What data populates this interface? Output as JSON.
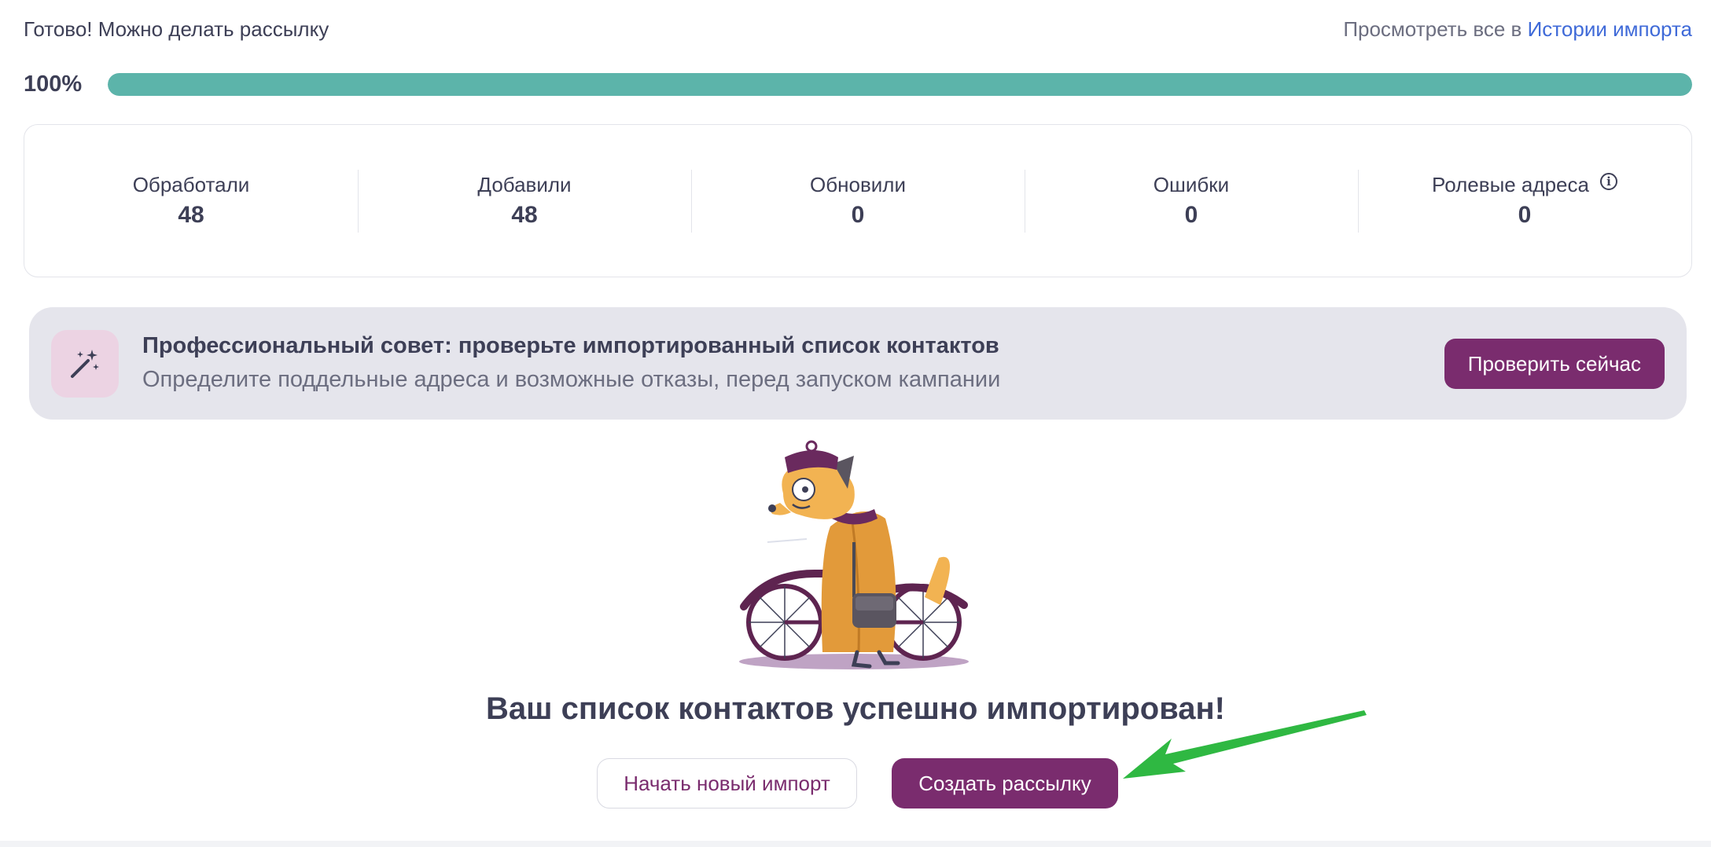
{
  "header": {
    "status_text": "Готово! Можно делать рассылку",
    "history_prefix": "Просмотреть все в ",
    "history_link": "Истории импорта"
  },
  "progress": {
    "label": "100%",
    "value": 1.0
  },
  "stats": [
    {
      "label": "Обработали",
      "value": "48"
    },
    {
      "label": "Добавили",
      "value": "48"
    },
    {
      "label": "Обновили",
      "value": "0"
    },
    {
      "label": "Ошибки",
      "value": "0"
    },
    {
      "label": "Ролевые адреса",
      "value": "0"
    }
  ],
  "tip": {
    "title": "Профессиональный совет: проверьте импортированный список контактов",
    "description": "Определите поддельные адреса и возможные отказы, перед запуском кампании",
    "button": "Проверить сейчас",
    "icon": "magic-wand-icon"
  },
  "result": {
    "title": "Ваш список контактов успешно импортирован!",
    "new_import_button": "Начать новый импорт",
    "create_campaign_button": "Создать рассылку"
  },
  "colors": {
    "accent": "#7a2c6e",
    "progress": "#5cb4aa",
    "link": "#3f6ad8",
    "annotation_arrow": "#2fb842"
  }
}
